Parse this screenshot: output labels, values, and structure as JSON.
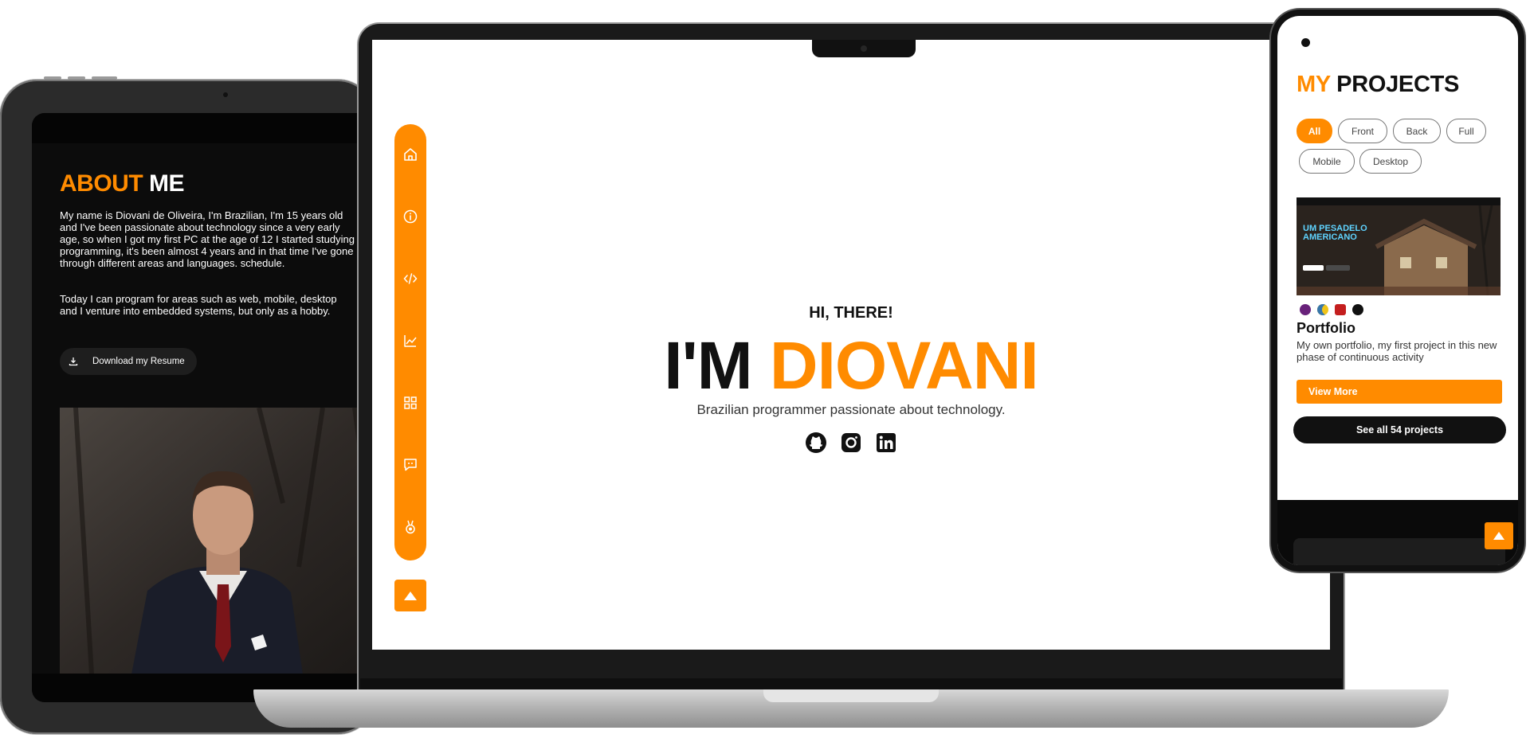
{
  "tablet": {
    "about_title_highlight": "ABOUT",
    "about_title_rest": "ME",
    "paragraph_1": "My name is Diovani de Oliveira, I'm Brazilian, I'm 15 years old and I've been passionate about technology since a very early age, so when I got my first PC at the age of 12 I started studying programming, it's been almost 4 years and in that time I've gone through different areas and languages. schedule.",
    "paragraph_2": "Today I can program for areas such as web, mobile, desktop and I venture into embedded systems, but only as a hobby.",
    "download_label": "Download my Resume"
  },
  "laptop": {
    "greeting": "HI, THERE!",
    "headline_prefix": "I'M",
    "headline_name": "DIOVANI",
    "subtitle": "Brazilian programmer passionate about technology.",
    "nav_icons": [
      "home-icon",
      "info-icon",
      "code-icon",
      "chart-icon",
      "grid-icon",
      "chat-icon",
      "medal-icon"
    ],
    "socials": [
      "github-icon",
      "instagram-icon",
      "linkedin-icon"
    ]
  },
  "phone": {
    "title_highlight": "MY",
    "title_rest": "PROJECTS",
    "filters": [
      "All",
      "Front",
      "Back",
      "Full",
      "Mobile",
      "Desktop"
    ],
    "active_filter": "All",
    "project": {
      "thumb_title": "UM PESADELO AMERICANO",
      "name": "Portfolio",
      "description": "My own portfolio, my first project in this new phase of continuous activity",
      "tech_icons": [
        "csharp-icon",
        "python-icon",
        "ruby-icon",
        "nextjs-icon"
      ]
    },
    "view_more_label": "View More",
    "see_all_label": "See all 54 projects"
  },
  "colors": {
    "accent": "#ff8b00",
    "dark": "#111111"
  }
}
